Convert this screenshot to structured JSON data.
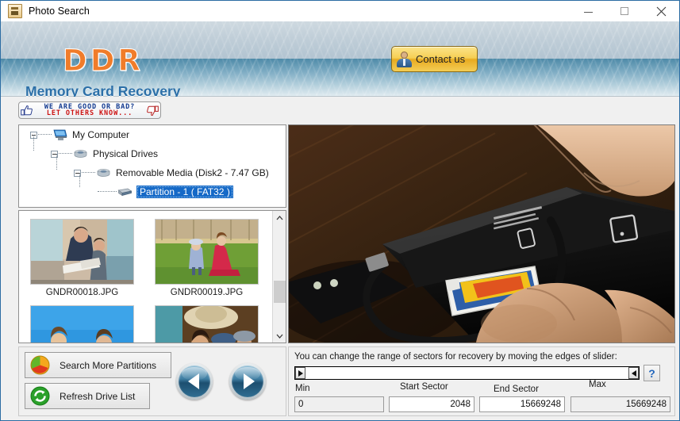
{
  "window": {
    "title": "Photo Search",
    "icon": "document-icon",
    "controls": {
      "minimize": "minimize-icon",
      "maximize": "maximize-icon",
      "close": "close-icon"
    }
  },
  "header": {
    "logo": "DDR",
    "subtitle": "Memory Card Recovery",
    "contact_label": "Contact us",
    "contact_icon": "user-icon"
  },
  "feedback": {
    "line1": "WE ARE GOOD OR BAD?",
    "line2": "LET OTHERS KNOW...",
    "thumb_up_icon": "thumbs-up-icon",
    "thumb_down_icon": "thumbs-down-icon"
  },
  "tree": {
    "nodes": [
      {
        "label": "My Computer",
        "icon": "computer-icon",
        "depth": 0,
        "expanded": true,
        "selected": false
      },
      {
        "label": "Physical Drives",
        "icon": "drive-icon",
        "depth": 1,
        "expanded": true,
        "selected": false
      },
      {
        "label": "Removable Media (Disk2 - 7.47 GB)",
        "icon": "drive-icon",
        "depth": 2,
        "expanded": true,
        "selected": false
      },
      {
        "label": "Partition - 1 ( FAT32 )",
        "icon": "partition-icon",
        "depth": 3,
        "expanded": false,
        "selected": true
      }
    ]
  },
  "thumbnails": {
    "items": [
      {
        "name": "GNDR00018.JPG",
        "alt": "woman-and-boy-reading-book"
      },
      {
        "name": "GNDR00019.JPG",
        "alt": "two-children-in-green-field"
      },
      {
        "name": "",
        "alt": "two-girls-against-blue-sky"
      },
      {
        "name": "",
        "alt": "group-of-people-with-hats"
      }
    ],
    "scroll": {
      "up_icon": "chevron-up-icon",
      "down_icon": "chevron-down-icon"
    }
  },
  "preview": {
    "alt": "hands-inserting-sd-card-into-black-card-reader"
  },
  "actions": {
    "search_more_partitions": "Search More Partitions",
    "search_icon": "pie-chart-icon",
    "refresh_drive_list": "Refresh Drive List",
    "refresh_icon": "refresh-icon",
    "prev_icon": "previous-arrow-icon",
    "next_icon": "next-arrow-icon"
  },
  "sector_range": {
    "hint": "You can change the range of sectors for recovery by moving the edges of slider:",
    "help_label": "?",
    "min_label": "Min",
    "min_value": "0",
    "start_label": "Start Sector",
    "start_value": "2048",
    "end_label": "End Sector",
    "end_value": "15669248",
    "max_label": "Max",
    "max_value": "15669248"
  },
  "colors": {
    "accent_blue": "#2b6fa8",
    "logo_orange": "#f07c2a",
    "selection_blue": "#1569c7",
    "contact_gold": "#f6cf54",
    "feedback_blue": "#12398f",
    "feedback_red": "#cc1111"
  }
}
